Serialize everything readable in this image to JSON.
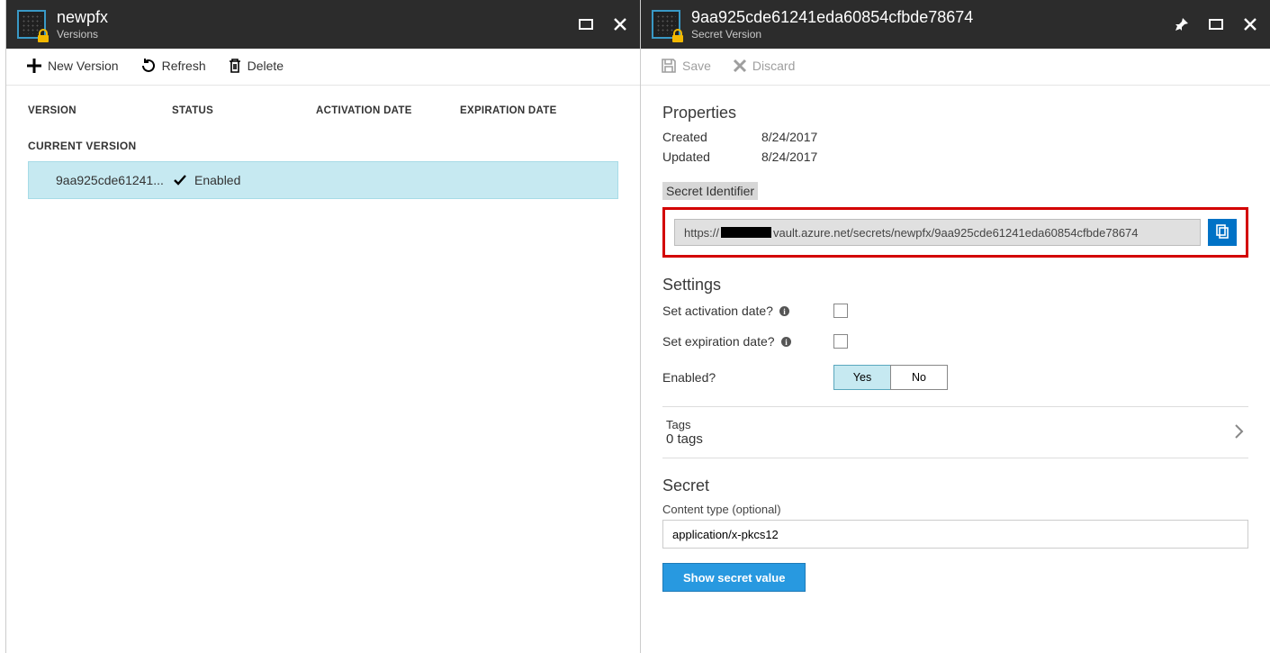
{
  "left": {
    "title": "newpfx",
    "subtitle": "Versions",
    "toolbar": {
      "new_version": "New Version",
      "refresh": "Refresh",
      "delete": "Delete"
    },
    "columns": {
      "version": "VERSION",
      "status": "STATUS",
      "activation": "ACTIVATION DATE",
      "expiration": "EXPIRATION DATE"
    },
    "current_version_label": "CURRENT VERSION",
    "row": {
      "id_display": "9aa925cde61241...",
      "status": "Enabled"
    }
  },
  "right": {
    "title": "9aa925cde61241eda60854cfbde78674",
    "subtitle": "Secret Version",
    "toolbar": {
      "save": "Save",
      "discard": "Discard"
    },
    "properties": {
      "heading": "Properties",
      "created_label": "Created",
      "created": "8/24/2017",
      "updated_label": "Updated",
      "updated": "8/24/2017",
      "secret_identifier_label": "Secret Identifier",
      "secret_identifier_prefix": "https://",
      "secret_identifier_suffix": "vault.azure.net/secrets/newpfx/9aa925cde61241eda60854cfbde78674"
    },
    "settings": {
      "heading": "Settings",
      "activation_label": "Set activation date?",
      "expiration_label": "Set expiration date?",
      "enabled_label": "Enabled?",
      "yes": "Yes",
      "no": "No"
    },
    "tags": {
      "label": "Tags",
      "count": "0 tags"
    },
    "secret": {
      "heading": "Secret",
      "content_type_label": "Content type (optional)",
      "content_type_value": "application/x-pkcs12",
      "show": "Show secret value"
    }
  }
}
